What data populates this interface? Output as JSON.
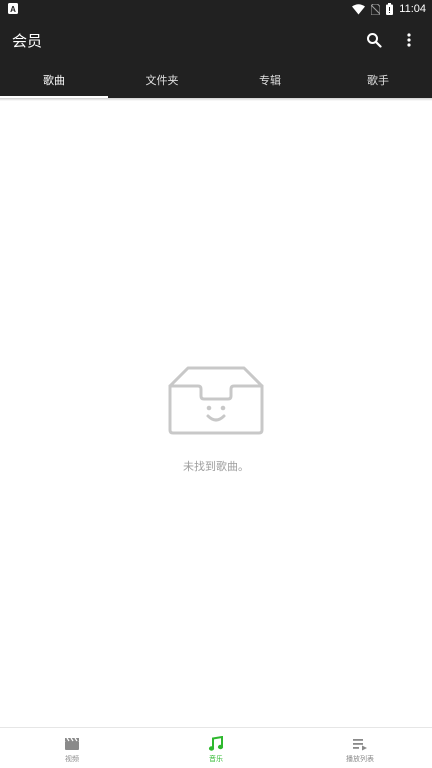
{
  "status_bar": {
    "time": "11:04",
    "left_icon": "a-notification-icon",
    "icons": [
      "wifi-icon",
      "no-sim-icon",
      "battery-icon"
    ]
  },
  "app_bar": {
    "title": "会员",
    "actions": [
      "search-icon",
      "more-vert-icon"
    ]
  },
  "tabs": [
    {
      "label": "歌曲",
      "active": true
    },
    {
      "label": "文件夹",
      "active": false
    },
    {
      "label": "专辑",
      "active": false
    },
    {
      "label": "歌手",
      "active": false
    }
  ],
  "empty_state": {
    "icon": "empty-box-smile-icon",
    "message": "未找到歌曲。"
  },
  "bottom_nav": [
    {
      "label": "视频",
      "icon": "video-clapper-icon",
      "active": false
    },
    {
      "label": "音乐",
      "icon": "music-note-icon",
      "active": true
    },
    {
      "label": "播放列表",
      "icon": "playlist-icon",
      "active": false
    }
  ],
  "colors": {
    "appbar": "#212121",
    "accent_green": "#2eb82e",
    "muted_text": "#9e9e9e",
    "icon_gray": "#c8c8c8"
  }
}
